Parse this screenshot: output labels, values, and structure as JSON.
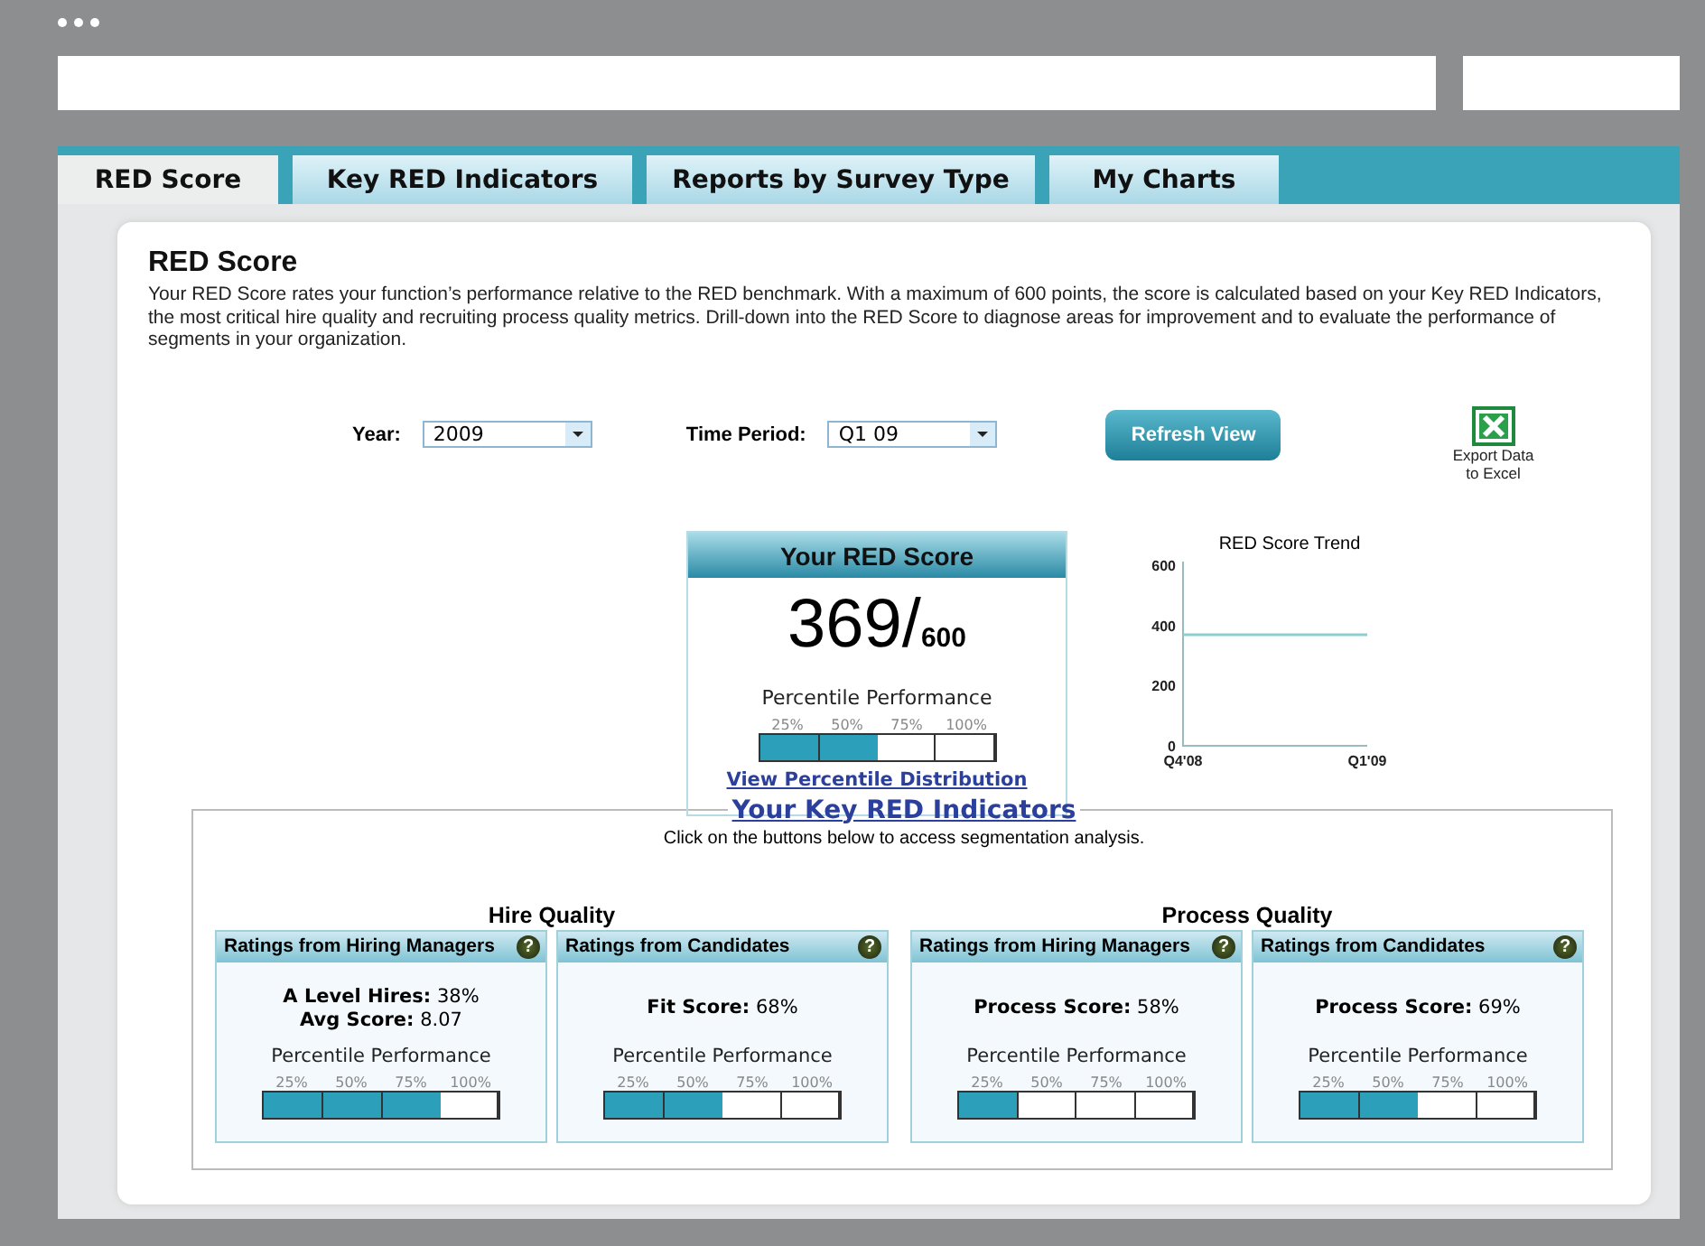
{
  "tabs": [
    {
      "label": "RED Score",
      "selected": true
    },
    {
      "label": "Key RED Indicators",
      "selected": false
    },
    {
      "label": "Reports by Survey Type",
      "selected": false
    },
    {
      "label": "My Charts",
      "selected": false
    }
  ],
  "page": {
    "title": "RED Score",
    "description": "Your RED Score rates your function’s performance relative to the RED benchmark. With a maximum of 600 points, the score is calculated based on your Key RED Indicators, the most critical hire quality and recruiting process quality metrics. Drill-down into the RED Score to diagnose areas for improvement and to evaluate the performance of segments in your organization."
  },
  "filters": [
    {
      "label": "Year:",
      "value": "2009"
    },
    {
      "label": "Time Period:",
      "value": "Q1 09"
    }
  ],
  "refresh_button": "Refresh View",
  "export": {
    "label_lines": [
      "Export Data",
      "to Excel"
    ]
  },
  "score": {
    "title": "Your RED Score",
    "value": "369/",
    "max": "600",
    "caption": "Percentile Performance",
    "ticks": [
      "25%",
      "50%",
      "75%",
      "100%"
    ],
    "level": 0.5,
    "link": "View Percentile Distribution"
  },
  "trend": {
    "chart_data": {
      "type": "line",
      "title": "RED Score Trend",
      "categories": [
        "Q4'08",
        "Q1'09"
      ],
      "series": [
        {
          "color": "#8ccfd0",
          "values": [
            369,
            369
          ]
        }
      ],
      "ylim": [
        0,
        600
      ],
      "yticks": [
        0,
        200,
        400,
        600
      ]
    }
  },
  "indicators": {
    "title": "Your Key RED Indicators",
    "hint": "Click on the buttons below to access segmentation analysis.",
    "groups": [
      {
        "title": "Hire Quality",
        "cards": [
          {
            "title": "Ratings from Hiring Managers",
            "help": "?",
            "metrics": [
              "**A Level Hires:** 38%",
              "**Avg Score:** 8.07"
            ],
            "caption": "Percentile Performance",
            "ticks": [
              "25%",
              "50%",
              "75%",
              "100%"
            ],
            "level": 0.75
          },
          {
            "title": "Ratings from Candidates",
            "help": "?",
            "metrics": [
              "**Fit Score:** 68%"
            ],
            "caption": "Percentile Performance",
            "ticks": [
              "25%",
              "50%",
              "75%",
              "100%"
            ],
            "level": 0.5
          }
        ]
      },
      {
        "title": "Process Quality",
        "cards": [
          {
            "title": "Ratings from Hiring Managers",
            "help": "?",
            "metrics": [
              "**Process Score:** 58%"
            ],
            "caption": "Percentile Performance",
            "ticks": [
              "25%",
              "50%",
              "75%",
              "100%"
            ],
            "level": 0.25
          },
          {
            "title": "Ratings from Candidates",
            "help": "?",
            "metrics": [
              "**Process Score:** 69%"
            ],
            "caption": "Percentile Performance",
            "ticks": [
              "25%",
              "50%",
              "75%",
              "100%"
            ],
            "level": 0.5
          }
        ]
      }
    ]
  }
}
